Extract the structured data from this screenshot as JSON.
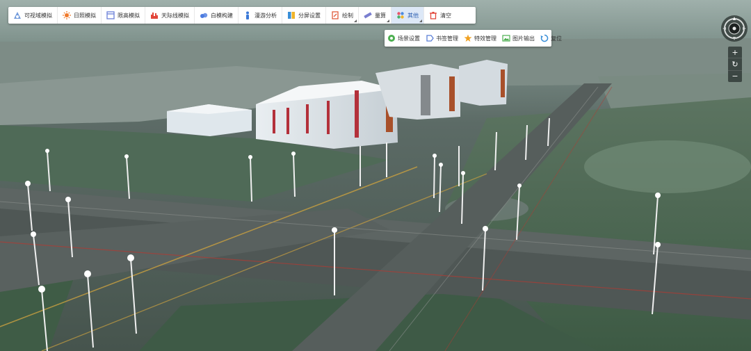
{
  "toolbar": {
    "items": [
      {
        "label": "可视域模拟",
        "icon": "visibility-icon",
        "color": "#5b8bd6"
      },
      {
        "label": "日照模拟",
        "icon": "sun-icon",
        "color": "#f07a2c"
      },
      {
        "label": "限高模拟",
        "icon": "height-limit-icon",
        "color": "#6a7fd8"
      },
      {
        "label": "天际线模拟",
        "icon": "skyline-icon",
        "color": "#e2463a"
      },
      {
        "label": "白模构建",
        "icon": "white-model-icon",
        "color": "#4b7be0"
      },
      {
        "label": "漫游分析",
        "icon": "roaming-icon",
        "color": "#3b79d8"
      },
      {
        "label": "分屏设置",
        "icon": "split-screen-icon",
        "color": "#3a8fd8"
      },
      {
        "label": "绘制",
        "icon": "draw-icon",
        "color": "#e05a3a"
      },
      {
        "label": "量算",
        "icon": "measure-icon",
        "color": "#7a7fd0"
      },
      {
        "label": "其他",
        "icon": "other-icon",
        "color": "#e8556a"
      },
      {
        "label": "清空",
        "icon": "clear-icon",
        "color": "#e2463a"
      }
    ]
  },
  "submenu": {
    "items": [
      {
        "label": "场景设置",
        "icon": "scene-settings-icon",
        "color": "#4caf50"
      },
      {
        "label": "书签管理",
        "icon": "bookmark-icon",
        "color": "#5b7fd6"
      },
      {
        "label": "特效管理",
        "icon": "effects-icon",
        "color": "#f0a020"
      },
      {
        "label": "图片输出",
        "icon": "image-export-icon",
        "color": "#4caf50"
      },
      {
        "label": "复位",
        "icon": "reset-icon",
        "color": "#3a8fd8"
      }
    ]
  },
  "navigation": {
    "compass_icon": "compass-icon",
    "zoom_in": "+",
    "reset": "↻",
    "zoom_out": "−"
  }
}
